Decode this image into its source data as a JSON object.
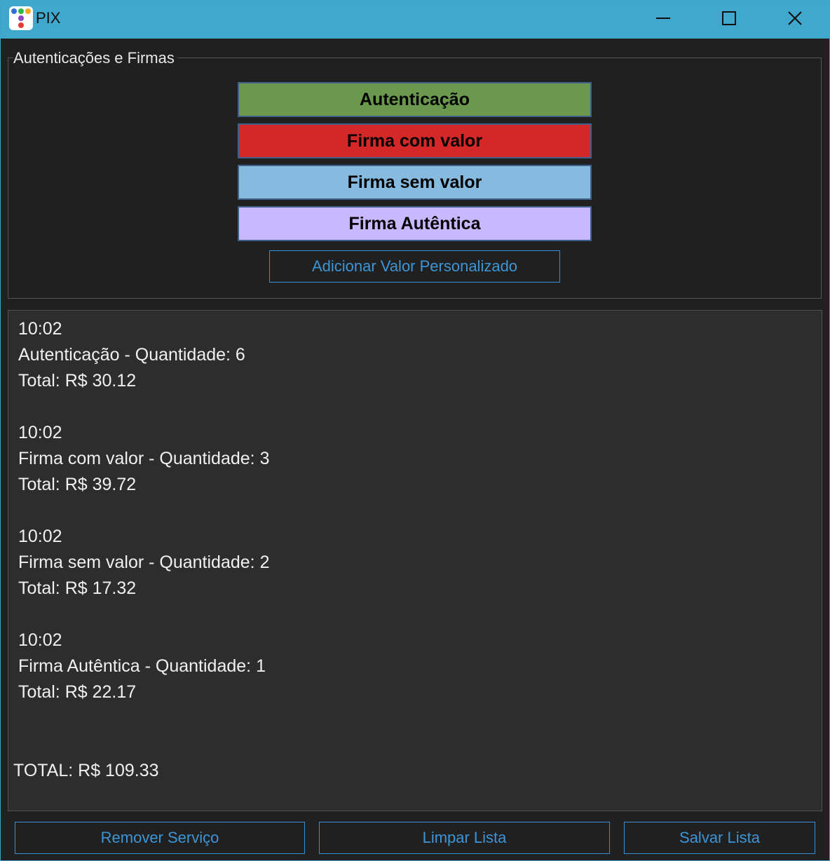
{
  "window": {
    "title": "PIX",
    "minimize_icon": "minimize-icon",
    "maximize_icon": "maximize-icon",
    "close_icon": "close-icon"
  },
  "group": {
    "legend": "Autenticações e Firmas",
    "buttons": [
      {
        "label": "Autenticação",
        "color": "#6a994e"
      },
      {
        "label": "Firma com valor",
        "color": "#d42828"
      },
      {
        "label": "Firma sem valor",
        "color": "#86bbdf"
      },
      {
        "label": "Firma Autêntica",
        "color": "#c8b8fd"
      }
    ],
    "custom_value_label": "Adicionar Valor Personalizado"
  },
  "log": {
    "entries": [
      {
        "time": "10:02",
        "description": "Autenticação - Quantidade: 6",
        "total": "Total: R$ 30.12"
      },
      {
        "time": "10:02",
        "description": "Firma com valor - Quantidade: 3",
        "total": "Total: R$ 39.72"
      },
      {
        "time": "10:02",
        "description": "Firma sem valor - Quantidade: 2",
        "total": "Total: R$ 17.32"
      },
      {
        "time": "10:02",
        "description": "Firma Autêntica - Quantidade: 1",
        "total": "Total: R$ 22.17"
      }
    ],
    "grand_total": "TOTAL: R$ 109.33"
  },
  "footer": {
    "remove_label": "Remover Serviço",
    "clear_label": "Limpar Lista",
    "save_label": "Salvar Lista"
  },
  "colors": {
    "titlebar": "#40a8cc",
    "accent": "#3d95d6",
    "background": "#202020",
    "log_background": "#2d2d2d"
  }
}
